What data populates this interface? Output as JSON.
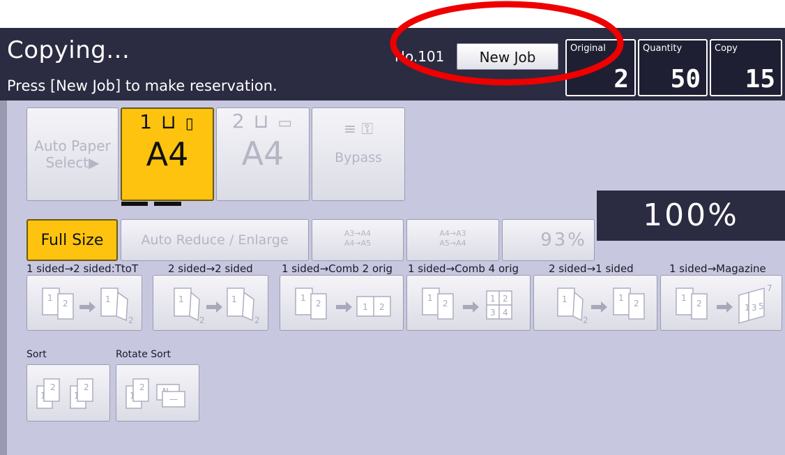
{
  "header": {
    "title": "Copying...",
    "subtitle": "Press [New Job] to make reservation.",
    "job_number": "No.101",
    "new_job_label": "New Job",
    "counters": [
      {
        "label": "Original",
        "value": "2"
      },
      {
        "label": "Quantity",
        "value": "50"
      },
      {
        "label": "Copy",
        "value": "15"
      }
    ]
  },
  "paper": {
    "auto_select_label": "Auto Paper Select▶",
    "trays": [
      {
        "number": "1",
        "size": "A4",
        "selected": true
      },
      {
        "number": "2",
        "size": "A4",
        "selected": false
      }
    ],
    "bypass_label": "Bypass"
  },
  "ratio": {
    "full_size_label": "Full Size",
    "auto_reduce_label": "Auto Reduce / Enlarge",
    "preset_1": [
      "A3→A4",
      "A4→A5"
    ],
    "preset_2": [
      "A4→A3",
      "A5→A4"
    ],
    "preset_pct": "93%",
    "current": "100%"
  },
  "duplex": [
    {
      "label": "1 sided→2 sided:TtoT"
    },
    {
      "label": "2 sided→2 sided"
    },
    {
      "label": "1 sided→Comb 2 orig"
    },
    {
      "label": "1 sided→Comb 4 orig"
    },
    {
      "label": "2 sided→1 sided"
    },
    {
      "label": "1 sided→Magazine"
    }
  ],
  "finishing": {
    "sort_label": "Sort",
    "rotate_sort_label": "Rotate Sort"
  },
  "colors": {
    "header_bg": "#2b2b41",
    "panel_bg": "#c7c7df",
    "selected": "#fdc30e",
    "annotation": "#ee0000"
  }
}
